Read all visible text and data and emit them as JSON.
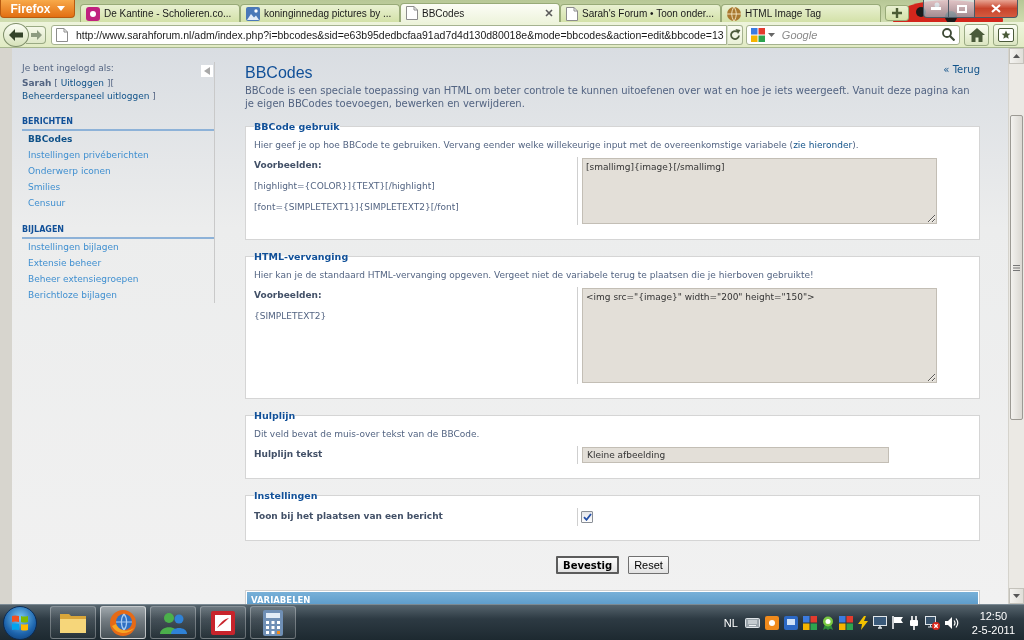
{
  "browser": {
    "menu_button": "Firefox",
    "tabs": [
      {
        "kind": "tile",
        "label": "De Kantine - Scholieren.co...",
        "selected": false
      },
      {
        "kind": "photo",
        "label": "koninginnedag pictures by ...",
        "selected": false
      },
      {
        "kind": "page",
        "label": "BBCodes",
        "selected": true
      },
      {
        "kind": "page",
        "label": "Sarah's Forum • Toon onder...",
        "selected": false
      },
      {
        "kind": "globe",
        "label": "HTML Image Tag",
        "selected": false
      }
    ],
    "address": "http://www.sarahforum.nl/adm/index.php?i=bbcodes&sid=e63b95dedbcfaa91ad7d4d130d80018e&mode=bbcodes&action=edit&bbcode=13",
    "search": {
      "placeholder": "Google"
    }
  },
  "sidebar": {
    "login_label": "Je bent ingelogd als:",
    "login_status": [
      {
        "kind": "user",
        "text": "Sarah"
      },
      {
        "kind": "text",
        "text": "["
      },
      {
        "kind": "link",
        "text": "Uitloggen"
      },
      {
        "kind": "text",
        "text": "]["
      },
      {
        "kind": "link",
        "text": "Beheerderspaneel uitloggen"
      },
      {
        "kind": "text",
        "text": "]"
      }
    ],
    "sections": [
      {
        "title": "BERICHTEN",
        "items": [
          {
            "label": "BBCodes",
            "selected": true
          },
          {
            "label": "Instellingen privéberichten",
            "selected": false
          },
          {
            "label": "Onderwerp iconen",
            "selected": false
          },
          {
            "label": "Smilies",
            "selected": false
          },
          {
            "label": "Censuur",
            "selected": false
          }
        ]
      },
      {
        "title": "BIJLAGEN",
        "items": [
          {
            "label": "Instellingen bijlagen",
            "selected": false
          },
          {
            "label": "Extensie beheer",
            "selected": false
          },
          {
            "label": "Beheer extensiegroepen",
            "selected": false
          },
          {
            "label": "Berichtloze bijlagen",
            "selected": false
          }
        ]
      }
    ]
  },
  "page": {
    "title": "BBCodes",
    "back_link": "« Terug",
    "intro": "BBCode is een speciale toepassing van HTML om beter controle te kunnen uitoefenen over wat en hoe je iets weergeeft. Vanuit deze pagina kan je eigen BBCodes toevoegen, bewerken en verwijderen."
  },
  "fieldsets": [
    {
      "kind": "textarea",
      "legend": "BBCode gebruik",
      "hint": "Hier geef je op hoe BBCode te gebruiken. Vervang eender welke willekeurige input met de overeenkomstige variabele (",
      "hint_link": "zie hieronder",
      "hint_end": ").",
      "label": "Voorbeelden:",
      "examples": [
        "[highlight={COLOR}]{TEXT}[/highlight]",
        "[font={SIMPLETEXT1}]{SIMPLETEXT2}[/font]"
      ],
      "value": "[smallimg]{image}[/smallimg]"
    },
    {
      "kind": "textarea",
      "legend": "HTML-vervanging",
      "hint": "Hier kan je de standaard HTML-vervanging opgeven. Vergeet niet de variabele terug te plaatsen die je hierboven gebruikte!",
      "label": "Voorbeelden:",
      "examples": [
        "{SIMPLETEXT2}"
      ],
      "value": "<img src=\"{image}\" width=\"200\" height=\"150\">"
    },
    {
      "kind": "input",
      "legend": "Hulplijn",
      "hint": "Dit veld bevat de muis-over tekst van de BBCode.",
      "label": "Hulplijn tekst",
      "value": "Kleine afbeelding"
    },
    {
      "kind": "checkbox",
      "legend": "Instellingen",
      "label": "Toon bij het plaatsen van een bericht",
      "checked": true
    }
  ],
  "buttons": [
    {
      "kind": "primary",
      "label": "Bevestig"
    },
    {
      "kind": "secondary",
      "label": "Reset"
    }
  ],
  "variables": {
    "title": "VARIABELEN"
  },
  "taskbar": {
    "apps": [
      {
        "kind": "folder",
        "selected": false
      },
      {
        "kind": "browser",
        "selected": true
      },
      {
        "kind": "messenger",
        "selected": false
      },
      {
        "kind": "document",
        "selected": false
      },
      {
        "kind": "calculator",
        "selected": false
      }
    ],
    "language": "NL",
    "time": "12:50",
    "date": "2-5-2011"
  }
}
